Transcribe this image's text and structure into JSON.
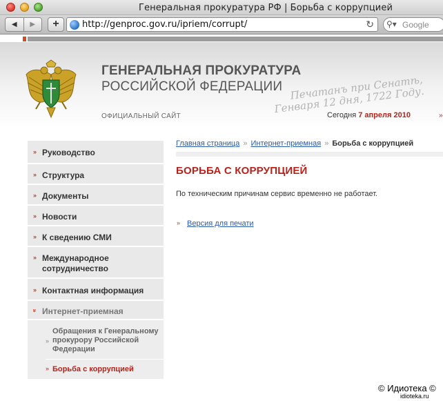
{
  "browser": {
    "window_title": "Генеральная прокуратура РФ | Борьба с коррупцией",
    "url": "http://genproc.gov.ru/ipriem/corrupt/",
    "search_placeholder": "Google",
    "back_glyph": "◀",
    "forward_glyph": "▶",
    "add_glyph": "+",
    "reload_glyph": "↻",
    "search_glyph": "⚲▾"
  },
  "header": {
    "org_line_1": "ГЕНЕРАЛЬНАЯ ПРОКУРАТУРА",
    "org_line_2": "РОССИЙСКОЙ ФЕДЕРАЦИИ",
    "official_site": "ОФИЦИАЛЬНЫЙ САЙТ",
    "handwriting_1": "Печатанъ при Сенатѣ,",
    "handwriting_2": "Генваря 12 дня, 1722 Году.",
    "today_label": "Сегодня",
    "today_date": "7 апреля 2010",
    "accent_color": "#b7231b"
  },
  "sidebar": {
    "bullet": "»",
    "items": [
      {
        "label": "Руководство"
      },
      {
        "label": "Структура"
      },
      {
        "label": "Документы"
      },
      {
        "label": "Новости"
      },
      {
        "label": "К сведению СМИ"
      },
      {
        "label": "Международное сотрудничество"
      },
      {
        "label": "Контактная информация"
      },
      {
        "label": "Интернет-приемная"
      }
    ],
    "sub_items": [
      {
        "label": "Обращения к Генеральному прокурору Российской Федерации"
      },
      {
        "label": "Борьба с коррупцией"
      }
    ]
  },
  "main": {
    "breadcrumbs": [
      "Главная страница",
      "Интернет-приемная",
      "Борьба с коррупцией"
    ],
    "crumb_sep": "»",
    "title": "БОРЬБА С КОРРУПЦИЕЙ",
    "message": "По техническим причинам сервис временно не работает.",
    "print_link": "Версия для печати"
  },
  "watermark": {
    "line_1": "© Идиотека ©",
    "line_2": "idioteka.ru"
  }
}
